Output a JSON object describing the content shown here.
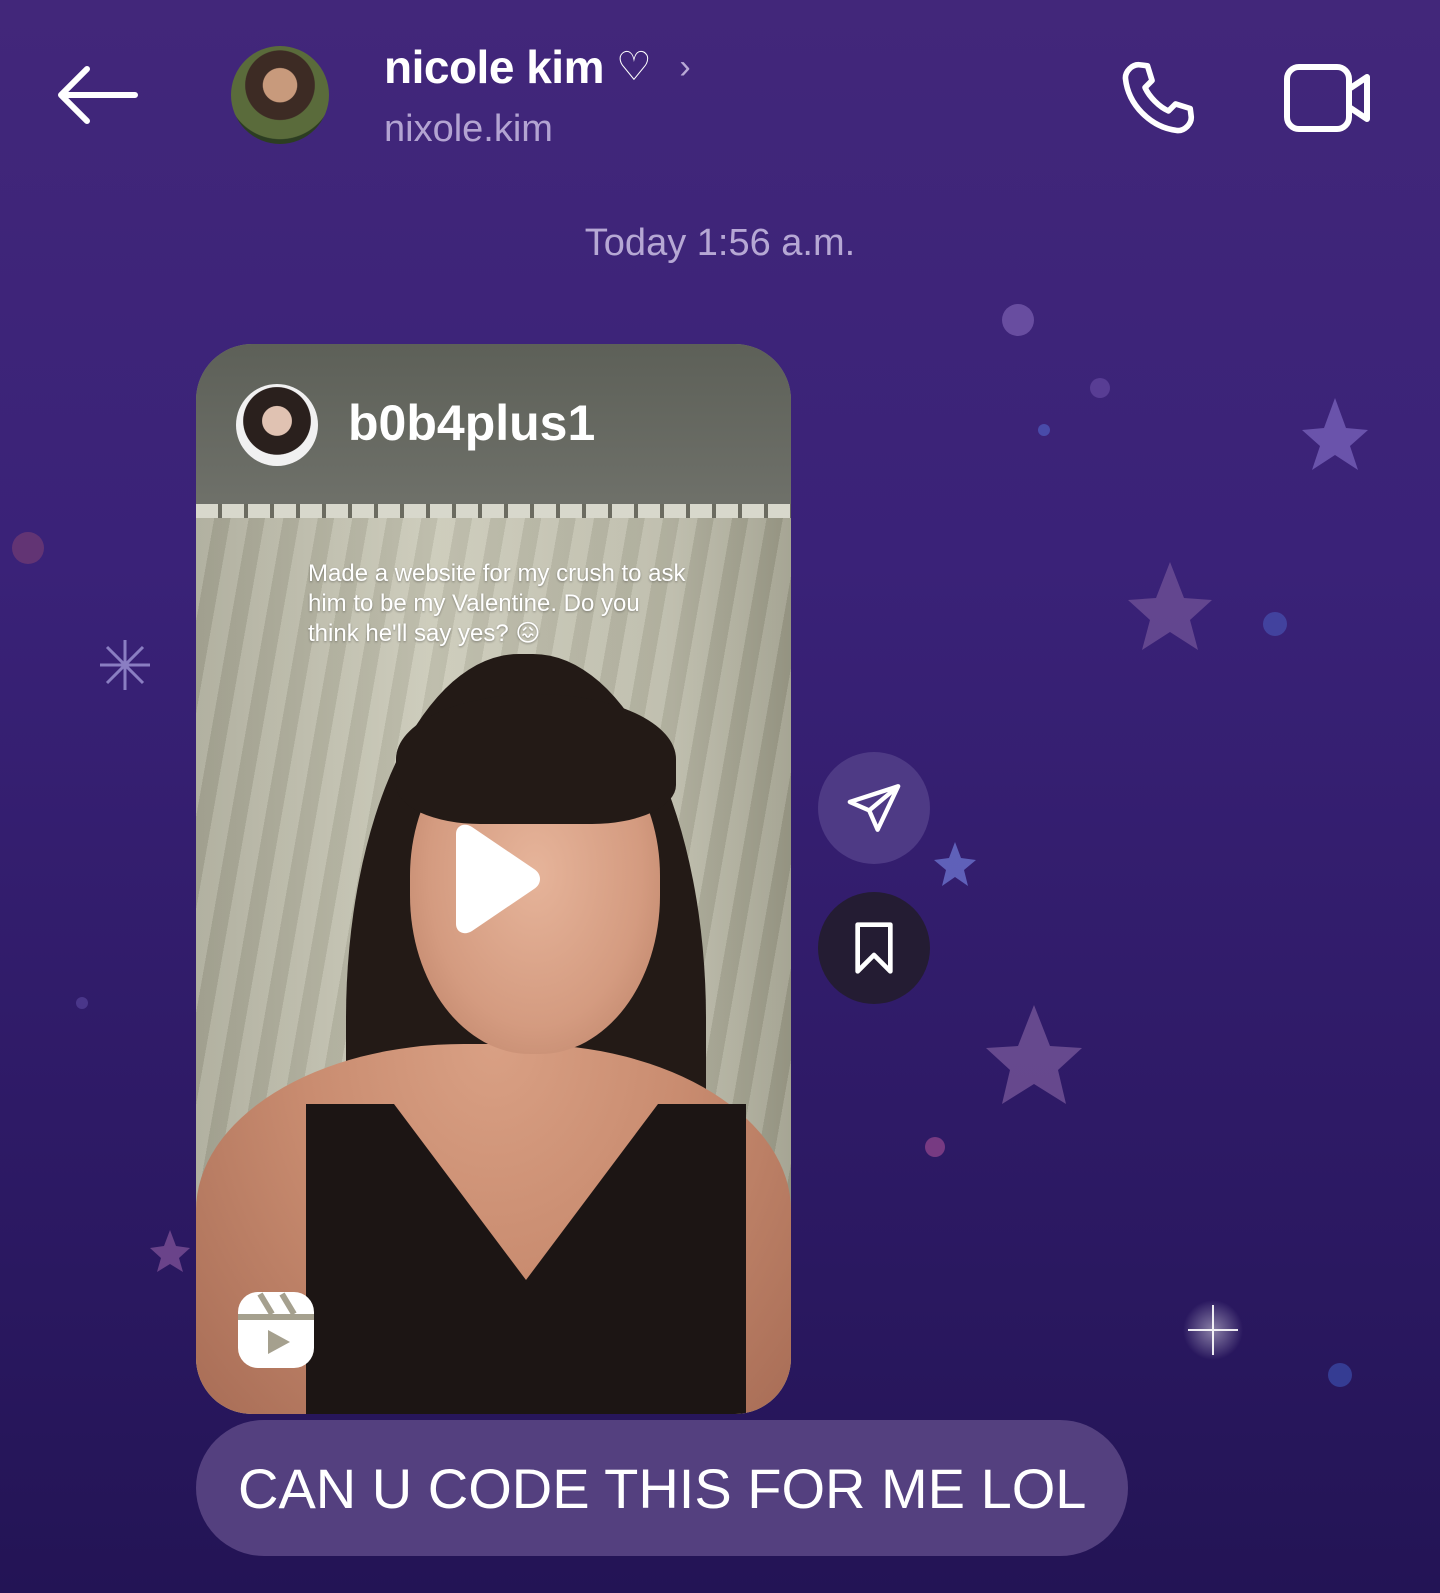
{
  "header": {
    "back_icon": "arrow-left-icon",
    "display_name": "nicole kim",
    "name_suffix_icon": "♡",
    "chevron_icon": "›",
    "username": "nixole.kim",
    "call_icon": "phone-icon",
    "video_icon": "video-camera-icon"
  },
  "timestamp": "Today 1:56 a.m.",
  "reel": {
    "username": "b0b4plus1",
    "caption": "Made a website for my crush to ask him to be my Valentine. Do you think he'll say yes? 😖",
    "play_icon": "play-icon",
    "reels_icon": "reels-icon"
  },
  "actions": {
    "share_icon": "paper-plane-icon",
    "save_icon": "bookmark-icon"
  },
  "message": {
    "text": "CAN U CODE THIS FOR ME LOL"
  },
  "colors": {
    "background_top": "#42277a",
    "background_bottom": "#231455",
    "bubble": "#54407f",
    "muted_text": "#b3a4d2"
  }
}
